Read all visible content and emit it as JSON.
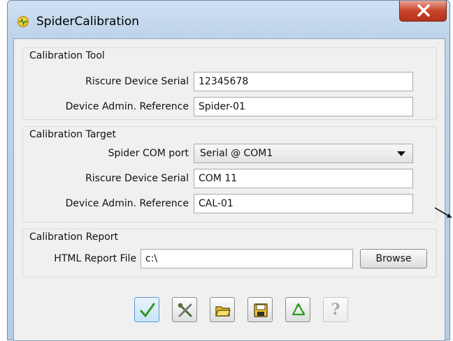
{
  "window": {
    "title": "SpiderCalibration",
    "close_icon": "close-icon"
  },
  "calibration_tool": {
    "legend": "Calibration Tool",
    "serial_label": "Riscure Device Serial",
    "serial_value": "12345678",
    "admin_label": "Device Admin. Reference",
    "admin_value": "Spider-01"
  },
  "calibration_target": {
    "legend": "Calibration Target",
    "com_port_label": "Spider COM port",
    "com_port_value": "Serial @ COM1",
    "serial_label": "Riscure Device Serial",
    "serial_value": "COM 11",
    "admin_label": "Device Admin. Reference",
    "admin_value": "CAL-01"
  },
  "calibration_report": {
    "legend": "Calibration Report",
    "file_label": "HTML Report File",
    "file_value": "c:\\",
    "browse_label": "Browse"
  },
  "toolbar": {
    "icons": [
      "checkmark-icon",
      "tools-icon",
      "folder-open-icon",
      "save-icon",
      "recycle-icon",
      "help-icon"
    ],
    "help_glyph": "?"
  },
  "colors": {
    "check_green": "#2e9a1e",
    "folder_yellow": "#e8c330",
    "close_red": "#c9442b"
  }
}
